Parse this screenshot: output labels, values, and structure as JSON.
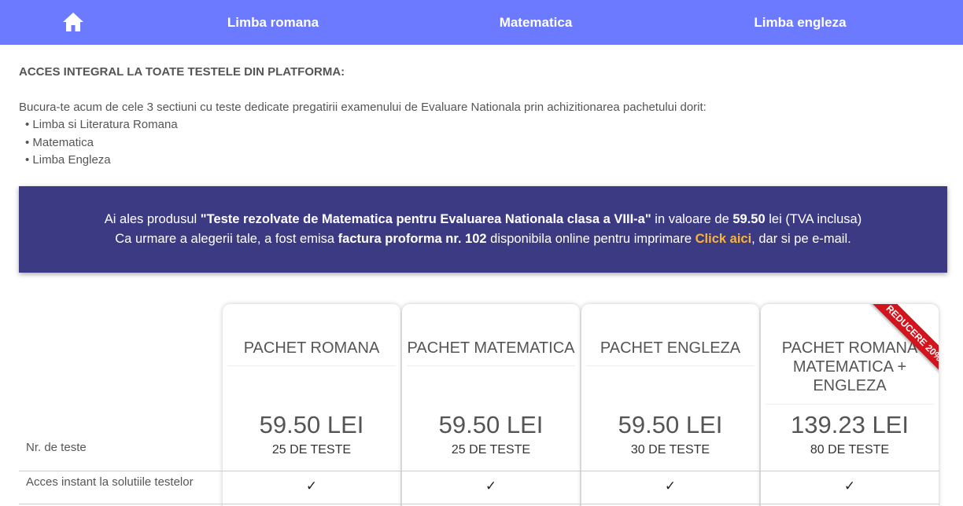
{
  "nav": {
    "home_icon": "home-icon",
    "items": [
      "Limba romana",
      "Matematica",
      "Limba engleza"
    ],
    "background": "#6b7aff"
  },
  "main": {
    "title": "ACCES INTEGRAL LA TOATE TESTELE DIN PLATFORMA:",
    "intro": "Bucura-te acum de cele 3 sectiuni cu teste dedicate pregatirii examenului de Evaluare Nationala prin achizitionarea pachetului dorit:",
    "bullets": [
      "• Limba si Literatura Romana",
      "• Matematica",
      "• Limba Engleza"
    ]
  },
  "banner": {
    "l1_a": "Ai ales produsul ",
    "l1_product": "\"Teste rezolvate de Matematica pentru Evaluarea Nationala clasa a VIII-a\"",
    "l1_b": " in valoare de ",
    "l1_price": "59.50",
    "l1_c": " lei (TVA inclusa)",
    "l2_a": "Ca urmare a alegerii tale, a fost emisa ",
    "l2_invoice": "factura proforma nr. 102",
    "l2_b": " disponibila online pentru imprimare ",
    "l2_link": "Click aici",
    "l2_c": ", dar si pe e-mail.",
    "background": "#3d3a84",
    "link_color": "#f6b53a"
  },
  "table": {
    "row_labels": [
      "Nr. de teste",
      "Acces instant la solutiile testelor"
    ],
    "packages": [
      {
        "title": "PACHET ROMANA",
        "price": "59.50 LEI",
        "tests": "25 DE TESTE",
        "check": "✓"
      },
      {
        "title": "PACHET MATEMATICA",
        "price": "59.50 LEI",
        "tests": "25 DE TESTE",
        "check": "✓"
      },
      {
        "title": "PACHET ENGLEZA",
        "price": "59.50 LEI",
        "tests": "30 DE TESTE",
        "check": "✓"
      },
      {
        "title_lines": [
          "PACHET ROMANA",
          "MATEMATICA +",
          "ENGLEZA"
        ],
        "price": "139.23 LEI",
        "tests": "80 DE TESTE",
        "check": "✓",
        "ribbon": "REDUCERE 20%"
      }
    ],
    "ribbon_color": "#d4141c"
  }
}
